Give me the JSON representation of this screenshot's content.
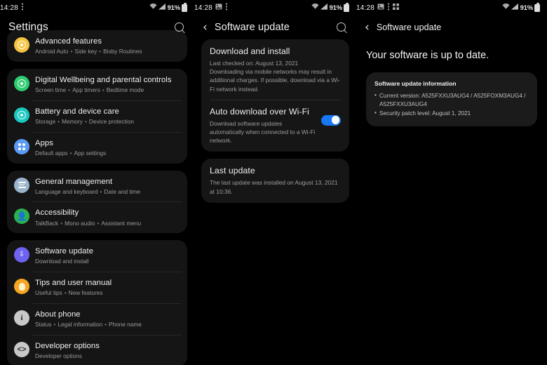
{
  "statusbar": {
    "time": "14:28",
    "battery_percent": "91%",
    "icons_left_p1": [
      "notification-dots-icon"
    ],
    "icons_left_p2": [
      "image-icon",
      "notification-dots-icon"
    ],
    "icons_left_p3": [
      "image-icon",
      "notification-dots-icon",
      "apps-grid-icon"
    ],
    "icons_right": [
      "wifi-icon",
      "signal-icon"
    ]
  },
  "colors": {
    "background": "#000000",
    "card": "#151515",
    "accent_toggle": "#1877f2",
    "icon_digital_wellbeing": "#2ecc71",
    "icon_battery": "#19c9c0",
    "icon_apps": "#5b9bf3",
    "icon_general": "#9ab4cc",
    "icon_accessibility": "#2bb14e",
    "icon_software_update": "#6c63ef",
    "icon_tips": "#f5a623",
    "icon_about": "#c8c8c8",
    "icon_developer": "#c8c8c8"
  },
  "panel1": {
    "appbar": {
      "title": "Settings",
      "search_icon": "search-icon"
    },
    "groups": [
      {
        "partial": true,
        "items": [
          {
            "title": "Advanced features",
            "subtitle_parts": [
              "Android Auto",
              "Side key",
              "Bixby Routines"
            ],
            "icon": "advanced-features-icon",
            "icon_color": "#f5c542"
          }
        ]
      },
      {
        "partial": false,
        "items": [
          {
            "title": "Digital Wellbeing and parental controls",
            "subtitle_parts": [
              "Screen time",
              "App timers",
              "Bedtime mode"
            ],
            "icon": "digital-wellbeing-icon",
            "icon_color": "#2ecc71"
          },
          {
            "title": "Battery and device care",
            "subtitle_parts": [
              "Storage",
              "Memory",
              "Device protection"
            ],
            "icon": "battery-care-icon",
            "icon_color": "#19c9c0"
          },
          {
            "title": "Apps",
            "subtitle_parts": [
              "Default apps",
              "App settings"
            ],
            "icon": "apps-icon",
            "icon_color": "#5b9bf3"
          }
        ]
      },
      {
        "partial": false,
        "items": [
          {
            "title": "General management",
            "subtitle_parts": [
              "Language and keyboard",
              "Date and time"
            ],
            "icon": "general-management-icon",
            "icon_color": "#9ab4cc"
          },
          {
            "title": "Accessibility",
            "subtitle_parts": [
              "TalkBack",
              "Mono audio",
              "Assistant menu"
            ],
            "icon": "accessibility-icon",
            "icon_color": "#2bb14e"
          }
        ]
      },
      {
        "partial": false,
        "items": [
          {
            "title": "Software update",
            "subtitle_parts": [
              "Download and install"
            ],
            "icon": "software-update-icon",
            "icon_color": "#6c63ef"
          },
          {
            "title": "Tips and user manual",
            "subtitle_parts": [
              "Useful tips",
              "New features"
            ],
            "icon": "tips-icon",
            "icon_color": "#f5a623"
          },
          {
            "title": "About phone",
            "subtitle_parts": [
              "Status",
              "Legal information",
              "Phone name"
            ],
            "icon": "about-phone-icon",
            "icon_color": "#c8c8c8"
          },
          {
            "title": "Developer options",
            "subtitle_parts": [
              "Developer options"
            ],
            "icon": "developer-options-icon",
            "icon_color": "#c8c8c8"
          }
        ]
      }
    ]
  },
  "panel2": {
    "appbar": {
      "back_icon": "back-chevron-icon",
      "title": "Software update",
      "search_icon": "search-icon"
    },
    "download_and_install": {
      "title": "Download and install",
      "last_checked": "Last checked on: August 13, 2021",
      "description": "Downloading via mobile networks may result in additional charges. If possible, download via a Wi-Fi network instead."
    },
    "auto_download": {
      "title": "Auto download over Wi-Fi",
      "description": "Download software updates automatically when connected to a Wi-Fi network.",
      "toggle_on": true
    },
    "last_update": {
      "title": "Last update",
      "description": "The last update was installed on August 13, 2021 at 10:36."
    }
  },
  "panel3": {
    "appbar": {
      "back_icon": "back-chevron-icon",
      "title": "Software update"
    },
    "headline": "Your software is up to date.",
    "info_card": {
      "heading": "Software update information",
      "bullets": [
        "Current version: A525FXXU3AUG4 / A525FOXM3AUG4 / A525FXXU3AUG4",
        "Security patch level: August 1, 2021"
      ]
    }
  }
}
